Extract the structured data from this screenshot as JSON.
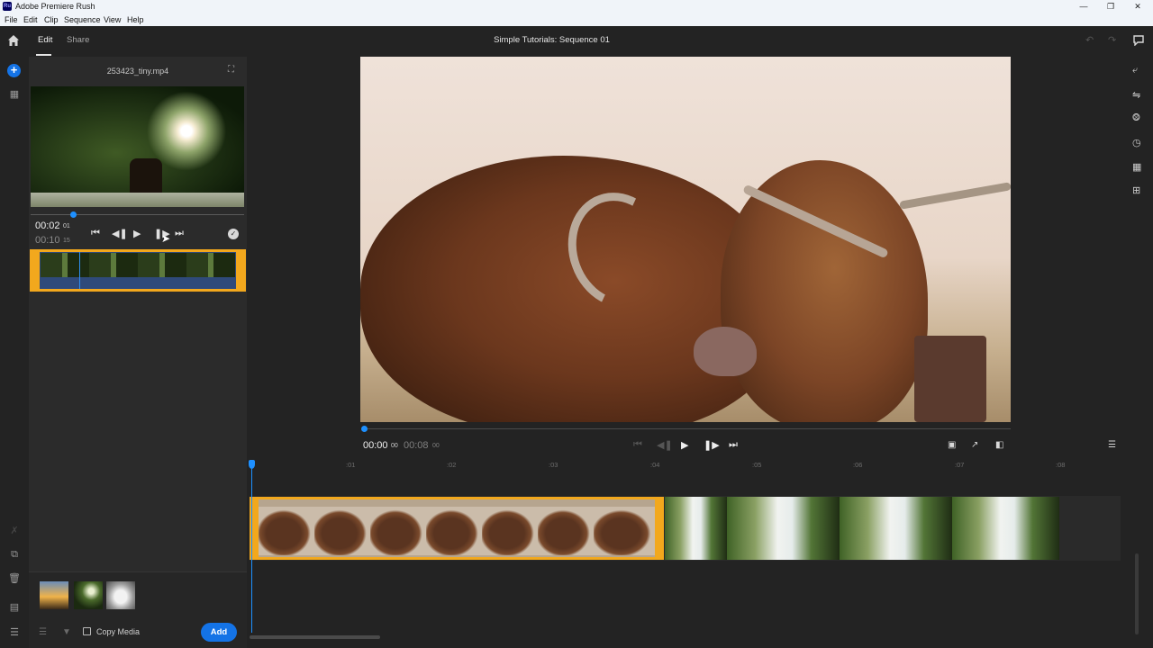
{
  "window": {
    "app_title": "Adobe Premiere Rush",
    "app_icon": "Ru",
    "controls": [
      "minimize-icon",
      "restore-icon",
      "close-icon"
    ]
  },
  "menu": [
    "File",
    "Edit",
    "Clip",
    "Sequence",
    "View",
    "Help"
  ],
  "header": {
    "tabs": [
      {
        "label": "Edit",
        "active": true
      },
      {
        "label": "Share",
        "active": false
      }
    ],
    "sequence_title": "Simple Tutorials: Sequence 01"
  },
  "source_panel": {
    "file_name": "253423_tiny.mp4",
    "current_time": "00:02",
    "current_frame": "01",
    "duration": "00:10",
    "duration_frame": "15",
    "playhead_fraction": 0.2
  },
  "media_bin": {
    "thumbnails": [
      "sunset-thumbnail",
      "tree-thumbnail",
      "white-horse-thumbnail"
    ],
    "copy_media_label": "Copy Media",
    "copy_media_checked": false,
    "add_label": "Add"
  },
  "program": {
    "current_time": "00:00",
    "current_frame": "00",
    "duration": "00:08",
    "duration_frame": "00",
    "playhead_fraction": 0.0
  },
  "timeline": {
    "ruler_labels": [
      ":01",
      ":02",
      ":03",
      ":04",
      ":05",
      ":06",
      ":07",
      ":08"
    ],
    "clips": [
      {
        "name": "highland-cattle-clip",
        "selected": true
      },
      {
        "name": "waterfall-clip",
        "selected": false
      }
    ]
  },
  "colors": {
    "accent": "#1473e6",
    "playhead": "#1e90ff",
    "selection": "#f2a81d",
    "background": "#232323",
    "panel": "#2b2b2b"
  }
}
